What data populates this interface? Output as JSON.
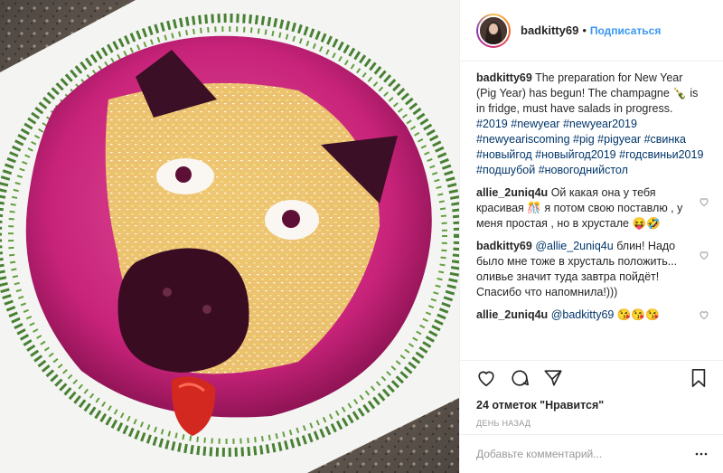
{
  "photo": {
    "alt": "beet salad shaped like a pig head with dill garnish"
  },
  "header": {
    "username": "badkitty69",
    "separator": "•",
    "follow_label": "Подписаться"
  },
  "caption": {
    "username": "badkitty69",
    "text_1": "The preparation for New Year (Pig Year) has begun! The champagne 🍾 is in fridge, must have salads in progress.",
    "hashtags": [
      "#2019",
      "#newyear",
      "#newyear2019",
      "#newyeariscoming",
      "#pig",
      "#pigyear",
      "#свинка",
      "#новыйгод",
      "#новыйгод2019",
      "#годсвиньи2019",
      "#подшубой",
      "#новогоднийстол"
    ]
  },
  "comments": [
    {
      "username": "allie_2uniq4u",
      "text": "Ой какая она у тебя красивая 🎊 я потом свою поставлю , у меня простая , но в хрустале 😝🤣"
    },
    {
      "username": "badkitty69",
      "mention": "@allie_2uniq4u",
      "text": "блин! Надо было мне тоже в хрусталь положить... оливье значит туда завтра пойдёт! Спасибо что напомнила!)))"
    },
    {
      "username": "allie_2uniq4u",
      "mention": "@badkitty69",
      "text": "😘😘😘"
    }
  ],
  "actions": {
    "likes_label": "24 отметок \"Нравится\"",
    "timestamp": "ДЕНЬ НАЗАД"
  },
  "add_comment": {
    "placeholder": "Добавьте комментарий..."
  },
  "colors": {
    "link": "#3897f0",
    "hashtag": "#003569",
    "muted": "#999999",
    "text": "#262626"
  }
}
